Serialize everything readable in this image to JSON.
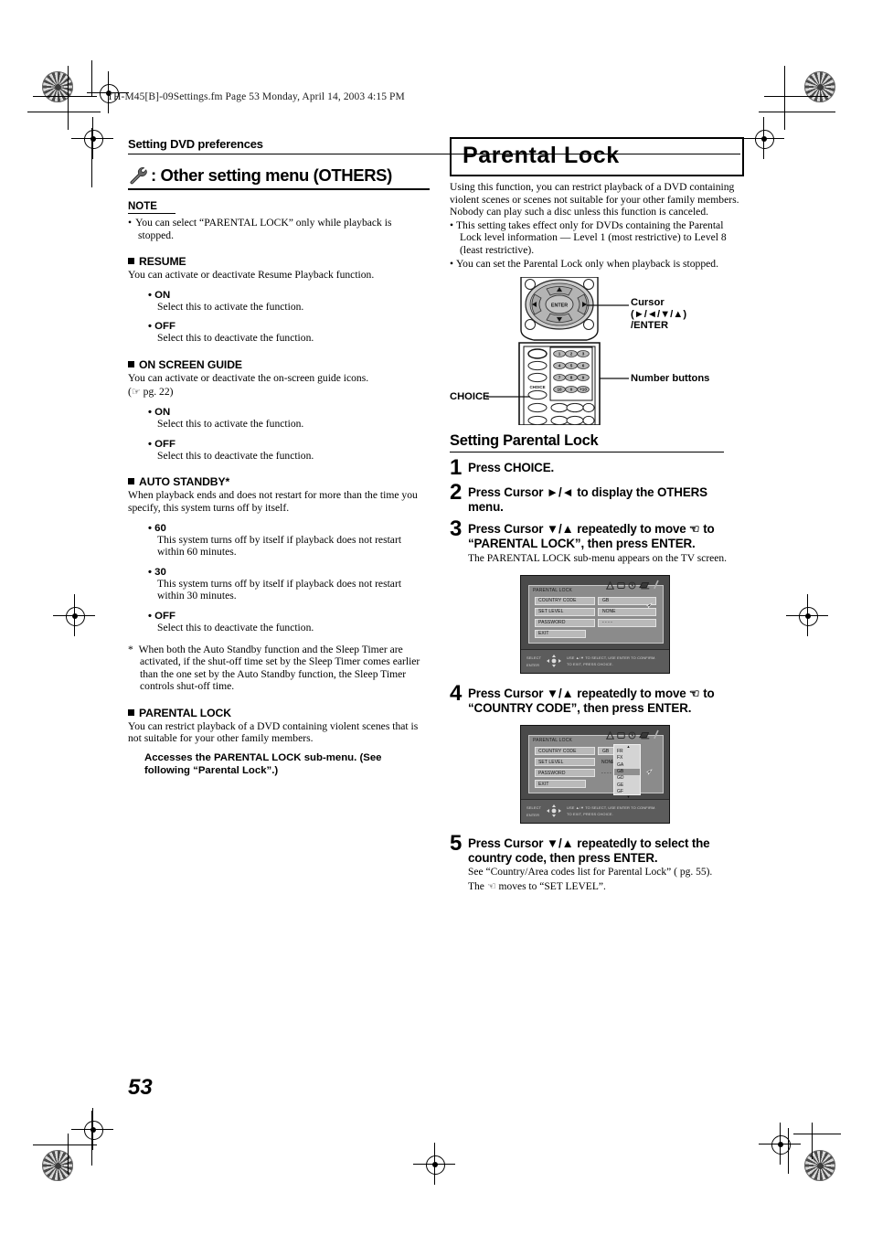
{
  "file_header": "TH-M45[B]-09Settings.fm  Page 53  Monday, April 14, 2003  4:15 PM",
  "page_number": "53",
  "left_column": {
    "running_head": "Setting DVD preferences",
    "section_icon": "wrench-icon",
    "section_title": ": Other setting menu (OTHERS)",
    "note": {
      "label": "NOTE",
      "bullet": "You can select “PARENTAL LOCK” only while playback is stopped."
    },
    "blocks": [
      {
        "heading": "RESUME",
        "intro": "You can activate or deactivate Resume Playback function.",
        "options": [
          {
            "name": "ON",
            "desc": "Select this to activate the function."
          },
          {
            "name": "OFF",
            "desc": "Select this to deactivate the function."
          }
        ]
      },
      {
        "heading": "ON SCREEN GUIDE",
        "intro": "You can activate or deactivate the on-screen guide icons.",
        "intro2": "( pg. 22)",
        "options": [
          {
            "name": "ON",
            "desc": "Select this to activate the function."
          },
          {
            "name": "OFF",
            "desc": "Select this to deactivate the function."
          }
        ]
      },
      {
        "heading": "AUTO STANDBY*",
        "intro": "When playback ends and does not restart for more than the time you specify, this system turns off by itself.",
        "options": [
          {
            "name": "60",
            "desc": "This system turns off by itself if playback does not restart within 60 minutes."
          },
          {
            "name": "30",
            "desc": "This system turns off by itself if playback does not restart within 30 minutes."
          },
          {
            "name": "OFF",
            "desc": "Select this to deactivate the function."
          }
        ],
        "footnote": "When both the Auto Standby function and the Sleep Timer are activated, if the shut-off time set by the Sleep Timer comes earlier than the one set by the Auto Standby function, the Sleep Timer controls shut-off time."
      },
      {
        "heading": "PARENTAL LOCK",
        "intro": "You can restrict playback of a DVD containing violent scenes that is not suitable for your other family members.",
        "bold_note": "Accesses the PARENTAL LOCK sub-menu. (See following “Parental Lock”.)"
      }
    ]
  },
  "right_column": {
    "title": "Parental Lock",
    "intro": "Using this function, you can restrict playback of a DVD containing violent scenes or scenes not suitable for your other family members. Nobody can play such a disc unless this function is canceled.",
    "bullets": [
      "This setting takes effect only for DVDs containing the Parental Lock level information — Level 1 (most restrictive) to Level 8 (least restrictive).",
      "You can set the Parental Lock only when playback is stopped."
    ],
    "remote": {
      "callout_cursor_line1": "Cursor",
      "callout_cursor_line2": "(►/◄/▼/▲)",
      "callout_cursor_line3": "/ENTER",
      "callout_number_buttons": "Number buttons",
      "callout_choice": "CHOICE",
      "enter_label": "ENTER",
      "choice_label": "CHOICE",
      "number_keys": [
        "1",
        "2",
        "3",
        "4",
        "5",
        "6",
        "7",
        "8",
        "9",
        "10",
        "0",
        "+10"
      ]
    },
    "procedure_title": "Setting Parental Lock",
    "steps": [
      {
        "num": "1",
        "text": "Press CHOICE."
      },
      {
        "num": "2",
        "text": "Press Cursor ►/◄ to display the OTHERS menu."
      },
      {
        "num": "3",
        "text_a": "Press Cursor ▼/▲ repeatedly to move",
        "text_b": " to “PARENTAL LOCK”, then press ENTER.",
        "sub": "The PARENTAL LOCK sub-menu appears on the TV screen."
      },
      {
        "num": "4",
        "text_a": "Press Cursor ▼/▲ repeatedly to move",
        "text_b": " to “COUNTRY CODE”, then press ENTER."
      },
      {
        "num": "5",
        "text": "Press Cursor ▼/▲ repeatedly to select the country code, then press ENTER.",
        "sub1": "See “Country/Area codes list for Parental Lock” ( pg. 55).",
        "sub2_a": "The ",
        "sub2_b": " moves to “SET LEVEL”."
      }
    ],
    "osd_screen_1": {
      "title": "PARENTAL LOCK",
      "rows": [
        {
          "key": "COUNTRY CODE",
          "value": "GB"
        },
        {
          "key": "SET LEVEL",
          "value": "NONE"
        },
        {
          "key": "PASSWORD",
          "value": "- - - -"
        }
      ],
      "exit": "EXIT",
      "hint_left_1": "SELECT",
      "hint_left_2": "ENTER",
      "hint_right_1": "USE ▲/▼ TO SELECT, USE ENTER TO CONFIRM.",
      "hint_right_2": "TO EXIT, PRESS CHOICE."
    },
    "osd_screen_2": {
      "title": "PARENTAL LOCK",
      "rows": [
        {
          "key": "COUNTRY CODE",
          "value": "GB"
        },
        {
          "key": "SET LEVEL",
          "value": "NONE"
        },
        {
          "key": "PASSWORD",
          "value": "- - - -"
        }
      ],
      "exit": "EXIT",
      "dropdown_options": [
        "FR",
        "FX",
        "GA",
        "GB",
        "GD",
        "GE",
        "GF"
      ],
      "dropdown_selected": "GB",
      "hint_left_1": "SELECT",
      "hint_left_2": "ENTER",
      "hint_right_1": "USE ▲/▼ TO SELECT, USE ENTER TO CONFIRM.",
      "hint_right_2": "TO EXIT, PRESS CHOICE."
    }
  }
}
